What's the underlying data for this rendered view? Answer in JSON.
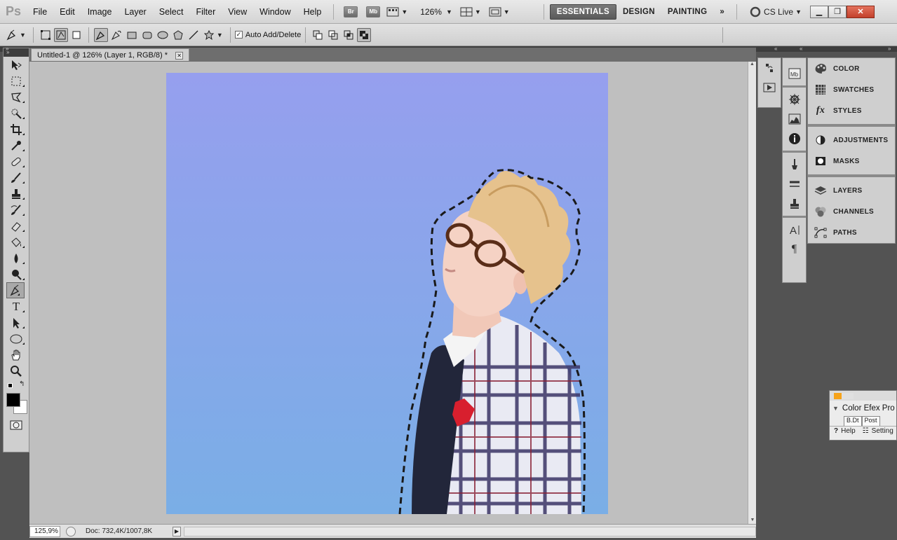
{
  "app": {
    "logo": "Ps"
  },
  "menu": [
    "File",
    "Edit",
    "Image",
    "Layer",
    "Select",
    "Filter",
    "View",
    "Window",
    "Help"
  ],
  "appbar": {
    "bridge": "Br",
    "minibridge": "Mb",
    "zoom": "126%"
  },
  "workspaces": [
    "ESSENTIALS",
    "DESIGN",
    "PAINTING"
  ],
  "cslive": "CS Live",
  "options": {
    "auto_add_delete": "Auto Add/Delete"
  },
  "document": {
    "tab_title": "Untitled-1 @ 126% (Layer 1, RGB/8) *"
  },
  "status": {
    "zoom": "125,9%",
    "doc_info": "Doc: 732,4K/1007,8K"
  },
  "panels": {
    "group1": [
      "COLOR",
      "SWATCHES",
      "STYLES"
    ],
    "group2": [
      "ADJUSTMENTS",
      "MASKS"
    ],
    "group3": [
      "LAYERS",
      "CHANNELS",
      "PATHS"
    ]
  },
  "efex": {
    "title": "Color Efex Pro",
    "tab1": "B.Dt",
    "tab2": "Post",
    "help": "Help",
    "settings": "Setting"
  },
  "colors": {
    "foreground": "#000000",
    "background": "#ffffff",
    "canvas_top": "#969fee",
    "canvas_bottom": "#7aaee6"
  }
}
